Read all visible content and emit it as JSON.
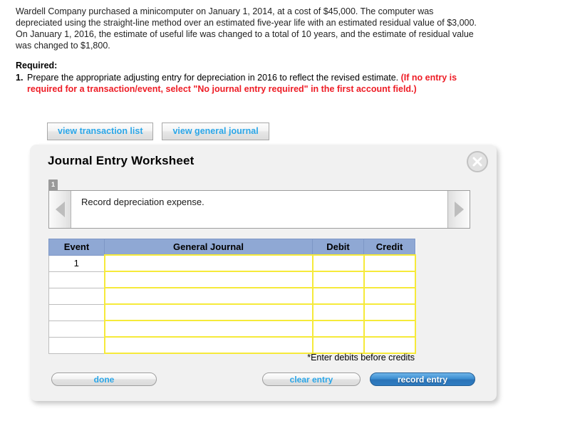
{
  "problem": {
    "text": "Wardell Company purchased a minicomputer on January 1, 2014, at a cost of $45,000. The computer was depreciated using the straight-line method over an estimated five-year life with an estimated residual value of $3,000. On January 1, 2016, the estimate of useful life was changed to a total of 10 years, and the estimate of residual value was changed to $1,800."
  },
  "required": {
    "label": "Required:",
    "item_number": "1.",
    "item_text": "Prepare the appropriate adjusting entry for depreciation in 2016 to reflect the revised estimate. ",
    "item_text_red": "(If no entry is required for a transaction/event, select \"No journal entry required\" in the first account field.)"
  },
  "tabs": [
    {
      "label": "view transaction list"
    },
    {
      "label": "view general journal"
    }
  ],
  "worksheet": {
    "title": "Journal Entry Worksheet",
    "close_icon": "close-icon",
    "page_badge": "1",
    "prev_icon": "chevron-left-icon",
    "next_icon": "chevron-right-icon",
    "prompt": "Record depreciation expense.",
    "table": {
      "headers": [
        "Event",
        "General Journal",
        "Debit",
        "Credit"
      ],
      "rows": [
        {
          "event": "1",
          "general_journal": "",
          "debit": "",
          "credit": ""
        },
        {
          "event": "",
          "general_journal": "",
          "debit": "",
          "credit": ""
        },
        {
          "event": "",
          "general_journal": "",
          "debit": "",
          "credit": ""
        },
        {
          "event": "",
          "general_journal": "",
          "debit": "",
          "credit": ""
        },
        {
          "event": "",
          "general_journal": "",
          "debit": "",
          "credit": ""
        },
        {
          "event": "",
          "general_journal": "",
          "debit": "",
          "credit": ""
        }
      ]
    },
    "note": "*Enter debits before credits",
    "buttons": {
      "done": "done",
      "clear_entry": "clear entry",
      "record_entry": "record entry"
    }
  },
  "colors": {
    "link_blue": "#2aa6e8",
    "table_header_blue": "#8fa8d4",
    "input_yellow": "#f6ea3a",
    "alert_red": "#ee1c25",
    "primary_button_blue": "#3d8fd1"
  }
}
